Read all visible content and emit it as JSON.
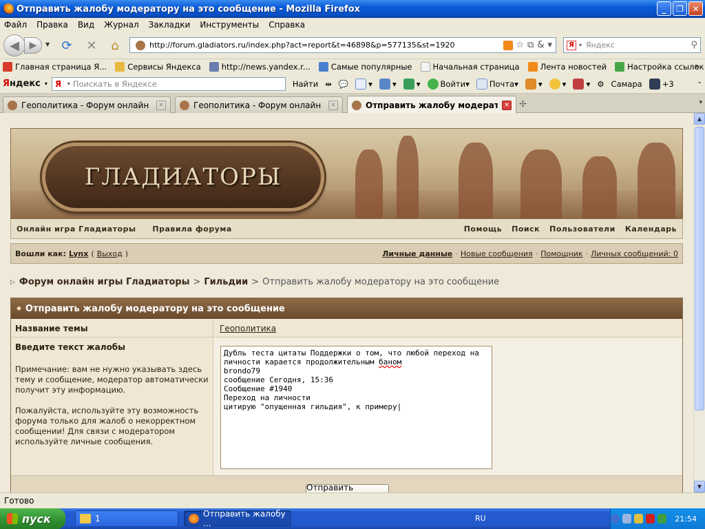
{
  "window": {
    "title": "Отправить жалобу модератору на это сообщение - Mozilla Firefox",
    "min": "_",
    "max": "❐",
    "close": "✕"
  },
  "menu": [
    "Файл",
    "Правка",
    "Вид",
    "Журнал",
    "Закладки",
    "Инструменты",
    "Справка"
  ],
  "nav": {
    "url": "http://forum.gladiators.ru/index.php?act=report&t=46898&p=577135&st=1920",
    "search_placeholder": "Яндекс"
  },
  "bookmarks": [
    {
      "label": "Главная страница Я...",
      "color": "#d63b2a"
    },
    {
      "label": "Сервисы Яндекса",
      "color": "#e8b840"
    },
    {
      "label": "http://news.yandex.r...",
      "color": "#6a7db0"
    },
    {
      "label": "Самые популярные",
      "color": "#4a7fd0"
    },
    {
      "label": "Начальная страница",
      "color": "#f4f4f4"
    },
    {
      "label": "Лента новостей",
      "color": "#f28a1a"
    },
    {
      "label": "Настройка ссылок",
      "color": "#47a647"
    }
  ],
  "bookmarks_more": "»",
  "yandex_bar": {
    "brand_part1": "Я",
    "brand_part2": "ндекс",
    "search_placeholder": "Поискать в Яндексе",
    "find": "Найти",
    "login": "Войти",
    "mail": "Почта",
    "city": "Самара",
    "temp": "+3"
  },
  "tabs": [
    {
      "label": "Геополитика - Форум онлайн игры Г..."
    },
    {
      "label": "Геополитика - Форум онлайн игры Г..."
    },
    {
      "label": "Отправить жалобу модератор..."
    }
  ],
  "forum": {
    "logo": "ГЛАДИАТОРЫ",
    "nav_left": [
      "Онлайн игра Гладиаторы",
      "Правила форума"
    ],
    "nav_right": [
      "Помощь",
      "Поиск",
      "Пользователи",
      "Календарь"
    ],
    "logged_as": "Вошли как:",
    "user": "Lynx",
    "logout": "Выход",
    "user_links": [
      "Личные данные",
      "Новые сообщения",
      "Помощник",
      "Личных сообщений: 0"
    ],
    "crumbs": [
      "Форум онлайн игры Гладиаторы",
      "Гильдии",
      "Отправить жалобу модератору на это сообщение"
    ],
    "panel_title": "Отправить жалобу модератору на это сообщение",
    "topic_label": "Название темы",
    "topic_value": "Геополитика",
    "complaint_label": "Введите текст жалобы",
    "note1": "Примечание: вам не нужно указывать здесь тему и сообщение, модератор автоматически получит эту информацию.",
    "note2": "Пожалуйста, используйте эту возможность форума только для жалоб о некорректном сообщении! Для связи с модератором используйте личные сообщения.",
    "complaint_lines": [
      "Дубль теста цитаты Поддержки о том, что любой переход на",
      "личности карается продолжительным ",
      "баном",
      "brondo79",
      "сообщение Сегодня, 15:36",
      "Сообщение #1940",
      "Переход на личности",
      "цитирую \"опущенная гильдия\", к примеру"
    ],
    "submit": "Отправить жалобу"
  },
  "status": "Готово",
  "taskbar": {
    "start": "пуск",
    "task1": "1",
    "task2": "Отправить жалобу ...",
    "lang": "RU",
    "clock": "21:54"
  }
}
